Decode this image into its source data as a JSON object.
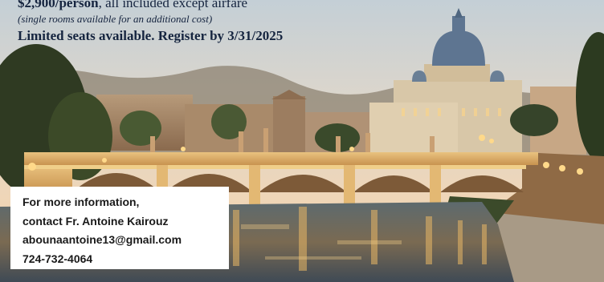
{
  "flyer": {
    "price_amount": "$2,900/person",
    "price_rest": ", all included except airfare",
    "single_rooms_note": "(single rooms available for an additional cost)",
    "deadline": "Limited seats available. Register by 3/31/2025"
  },
  "contact": {
    "line1": "For more information,",
    "line2": "contact Fr. Antoine Kairouz",
    "email": "abounaantoine13@gmail.com",
    "phone": "724-732-4064"
  },
  "photo": {
    "subject": "photo-rome-st-peters-basilica-bridge-dusk"
  }
}
